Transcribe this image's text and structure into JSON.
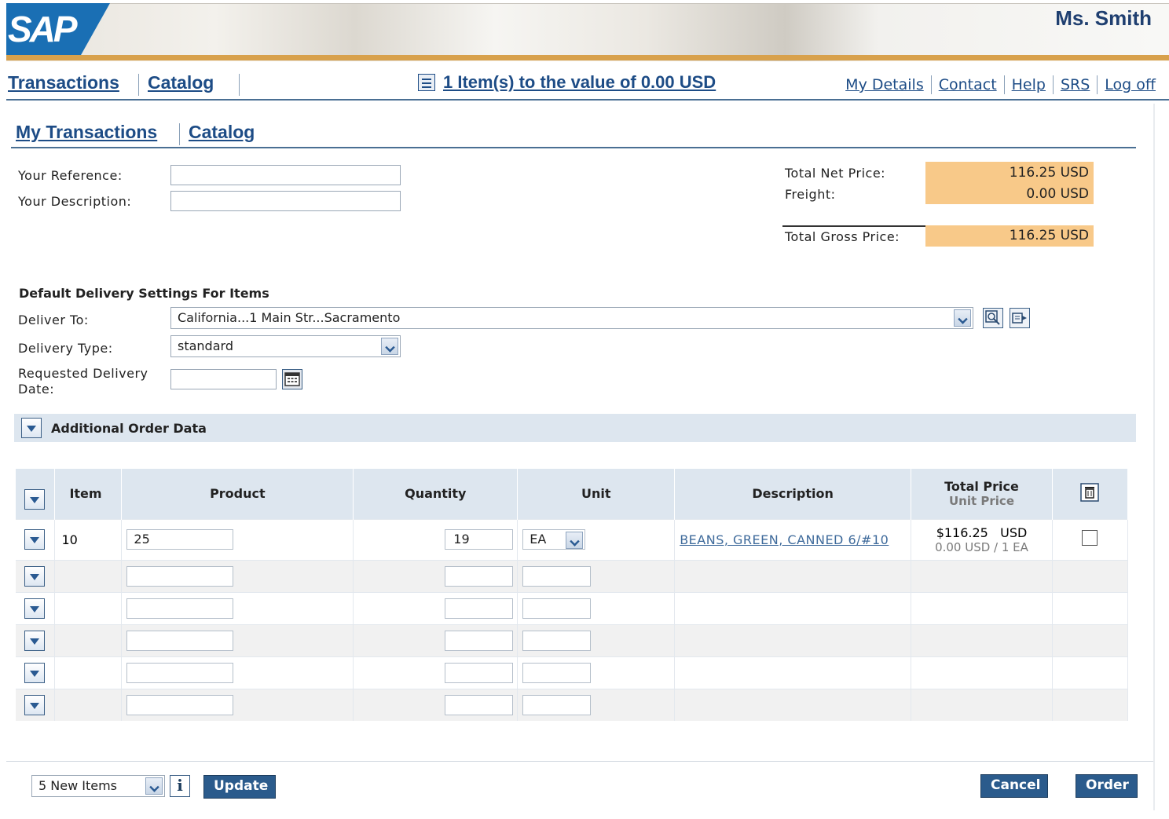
{
  "header": {
    "logo_text": "SAP",
    "user_name": "Ms. Smith"
  },
  "topnav": {
    "left_links": [
      "Transactions",
      "Catalog"
    ],
    "cart_summary": "1 Item(s) to the value of 0.00 USD",
    "right_links": [
      "My Details",
      "Contact",
      "Help",
      "SRS",
      "Log off"
    ]
  },
  "subnav": {
    "links": [
      "My Transactions",
      "Catalog"
    ]
  },
  "form": {
    "your_reference_label": "Your Reference:",
    "your_reference_value": "",
    "your_description_label": "Your Description:",
    "your_description_value": ""
  },
  "pricing": {
    "total_net_label": "Total Net Price:",
    "total_net_value": "116.25",
    "total_net_currency": "USD",
    "freight_label": "Freight:",
    "freight_value": "0.00 USD",
    "gross_label": "Total Gross Price:",
    "gross_value": "116.25",
    "gross_currency": "USD"
  },
  "delivery": {
    "section_title": "Default Delivery Settings For Items",
    "deliver_to_label": "Deliver To:",
    "deliver_to_value": "California...1 Main Str...Sacramento",
    "delivery_type_label": "Delivery Type:",
    "delivery_type_value": "standard",
    "requested_date_label_1": "Requested Delivery",
    "requested_date_label_2": "Date:",
    "requested_date_value": ""
  },
  "additional": {
    "title": "Additional Order Data"
  },
  "table": {
    "headers": {
      "item": "Item",
      "product": "Product",
      "quantity": "Quantity",
      "unit": "Unit",
      "description": "Description",
      "total_price": "Total Price",
      "unit_price": "Unit Price"
    },
    "rows": [
      {
        "item": "10",
        "product": "25",
        "quantity": "19",
        "unit": "EA",
        "description": "BEANS, GREEN, CANNED 6/#10",
        "total_price": "$116.25",
        "total_currency": "USD",
        "unit_price": "0.00 USD / 1 EA"
      }
    ]
  },
  "footer": {
    "new_items_select": "5 New Items",
    "update_button": "Update",
    "cancel_button": "Cancel",
    "order_button": "Order"
  },
  "colors": {
    "accent": "#1d4c86",
    "price_highlight": "#f8c989",
    "button": "#2b5b8c",
    "banner_stripe": "#d8a14c"
  },
  "icons": [
    "cart-icon",
    "dropdown-icon",
    "search-address-icon",
    "edit-address-icon",
    "calendar-icon",
    "expand-icon",
    "info-icon",
    "delete-icon"
  ]
}
